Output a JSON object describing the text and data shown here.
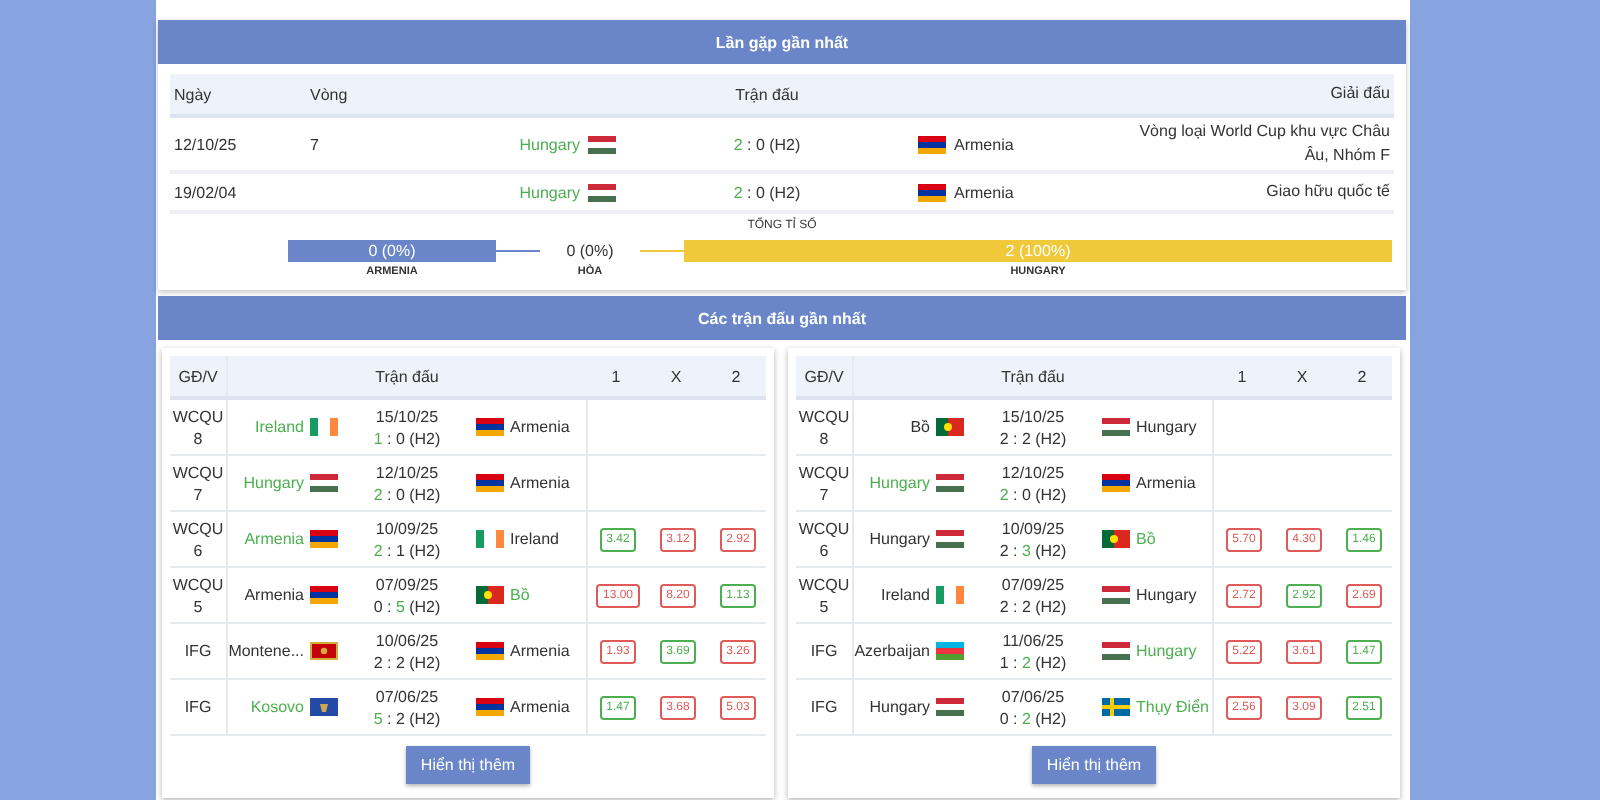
{
  "h2h": {
    "title": "Lần gặp gần nhất",
    "columns": [
      "Ngày",
      "Vòng",
      "Trận đấu",
      "Giải đấu"
    ],
    "rows": [
      {
        "date": "12/10/25",
        "round": "7",
        "home": {
          "name": "Hungary",
          "kind": "hungary",
          "won": true
        },
        "score_home": "2",
        "separator": ":",
        "score_away": "0",
        "note": "(H2)",
        "away": {
          "name": "Armenia",
          "kind": "armenia",
          "won": false
        },
        "league": "Vòng loại World Cup khu vực Châu Âu, Nhóm F"
      },
      {
        "date": "19/02/04",
        "home": {
          "name": "Hungary",
          "kind": "hungary",
          "won": true
        },
        "score_home": "2",
        "separator": ":",
        "score_away": "0",
        "note": "(H2)",
        "away": {
          "name": "Armenia",
          "kind": "armenia",
          "won": false
        },
        "league": "Giao hữu quốc tế"
      }
    ],
    "summary_title": "TỔNG TỈ SỐ",
    "totals": [
      {
        "kind": "away",
        "value": "0 (0%)",
        "label": "ARMENIA"
      },
      {
        "kind": "draw",
        "value": "0 (0%)",
        "label": "HÒA"
      },
      {
        "kind": "home",
        "value": "2 (100%)",
        "label": "HUNGARY"
      }
    ]
  },
  "recent": {
    "title": "Các trận đấu gần nhất",
    "cards": [
      {
        "columns": [
          "GĐ/V",
          "Trận đấu",
          "1",
          "X",
          "2"
        ],
        "button": "Hiển thị thêm",
        "rows": [
          {
            "round": "WCQU 8",
            "home": {
              "name": "Ireland",
              "kind": "ireland",
              "won": true
            },
            "date": "15/10/25",
            "score_home": "1",
            "separator": ":",
            "score_away": "0",
            "note": "(H2)",
            "away": {
              "name": "Armenia",
              "kind": "armenia",
              "won": false
            }
          },
          {
            "round": "WCQU 7",
            "home": {
              "name": "Hungary",
              "kind": "hungary",
              "won": true
            },
            "date": "12/10/25",
            "score_home": "2",
            "separator": ":",
            "score_away": "0",
            "note": "(H2)",
            "away": {
              "name": "Armenia",
              "kind": "armenia",
              "won": false
            }
          },
          {
            "round": "WCQU 6",
            "home": {
              "name": "Armenia",
              "kind": "armenia",
              "won": true
            },
            "date": "10/09/25",
            "score_home": "2",
            "separator": ":",
            "score_away": "1",
            "note": "(H2)",
            "away": {
              "name": "Ireland",
              "kind": "ireland",
              "won": false
            },
            "odds": [
              {
                "value": "3.42",
                "color": "#4caf50"
              },
              {
                "value": "3.12",
                "color": "#e05a5a"
              },
              {
                "value": "2.92",
                "color": "#e05a5a"
              }
            ]
          },
          {
            "round": "WCQU 5",
            "home": {
              "name": "Armenia",
              "kind": "armenia",
              "won": false
            },
            "date": "07/09/25",
            "score_home": "0",
            "separator": ":",
            "score_away": "5",
            "note": "(H2)",
            "away": {
              "name": "Bồ",
              "kind": "portugal",
              "won": true
            },
            "odds": [
              {
                "value": "13.00",
                "color": "#e05a5a"
              },
              {
                "value": "8.20",
                "color": "#e05a5a"
              },
              {
                "value": "1.13",
                "color": "#4caf50"
              }
            ]
          },
          {
            "round": "IFG",
            "home": {
              "name": "Montene...",
              "kind": "montenegro",
              "won": false
            },
            "date": "10/06/25",
            "score_home": "2",
            "separator": ":",
            "score_away": "2",
            "note": "(H2)",
            "away": {
              "name": "Armenia",
              "kind": "armenia",
              "won": false
            },
            "odds": [
              {
                "value": "1.93",
                "color": "#e05a5a"
              },
              {
                "value": "3.69",
                "color": "#4caf50"
              },
              {
                "value": "3.26",
                "color": "#e05a5a"
              }
            ]
          },
          {
            "round": "IFG",
            "home": {
              "name": "Kosovo",
              "kind": "kosovo",
              "won": true
            },
            "date": "07/06/25",
            "score_home": "5",
            "separator": ":",
            "score_away": "2",
            "note": "(H2)",
            "away": {
              "name": "Armenia",
              "kind": "armenia",
              "won": false
            },
            "odds": [
              {
                "value": "1.47",
                "color": "#4caf50"
              },
              {
                "value": "3.68",
                "color": "#e05a5a"
              },
              {
                "value": "5.03",
                "color": "#e05a5a"
              }
            ]
          }
        ]
      },
      {
        "columns": [
          "GĐ/V",
          "Trận đấu",
          "1",
          "X",
          "2"
        ],
        "button": "Hiển thị thêm",
        "rows": [
          {
            "round": "WCQU 8",
            "home": {
              "name": "Bồ",
              "kind": "portugal",
              "won": false
            },
            "date": "15/10/25",
            "score_home": "2",
            "separator": ":",
            "score_away": "2",
            "note": "(H2)",
            "away": {
              "name": "Hungary",
              "kind": "hungary",
              "won": false
            }
          },
          {
            "round": "WCQU 7",
            "home": {
              "name": "Hungary",
              "kind": "hungary",
              "won": true
            },
            "date": "12/10/25",
            "score_home": "2",
            "separator": ":",
            "score_away": "0",
            "note": "(H2)",
            "away": {
              "name": "Armenia",
              "kind": "armenia",
              "won": false
            }
          },
          {
            "round": "WCQU 6",
            "home": {
              "name": "Hungary",
              "kind": "hungary",
              "won": false
            },
            "date": "10/09/25",
            "score_home": "2",
            "separator": ":",
            "score_away": "3",
            "note": "(H2)",
            "away": {
              "name": "Bồ",
              "kind": "portugal",
              "won": true
            },
            "odds": [
              {
                "value": "5.70",
                "color": "#e05a5a"
              },
              {
                "value": "4.30",
                "color": "#e05a5a"
              },
              {
                "value": "1.46",
                "color": "#4caf50"
              }
            ]
          },
          {
            "round": "WCQU 5",
            "home": {
              "name": "Ireland",
              "kind": "ireland",
              "won": false
            },
            "date": "07/09/25",
            "score_home": "2",
            "separator": ":",
            "score_away": "2",
            "note": "(H2)",
            "away": {
              "name": "Hungary",
              "kind": "hungary",
              "won": false
            },
            "odds": [
              {
                "value": "2.72",
                "color": "#e05a5a"
              },
              {
                "value": "2.92",
                "color": "#4caf50"
              },
              {
                "value": "2.69",
                "color": "#e05a5a"
              }
            ]
          },
          {
            "round": "IFG",
            "home": {
              "name": "Azerbaijan",
              "kind": "azerbaijan",
              "won": false
            },
            "date": "11/06/25",
            "score_home": "1",
            "separator": ":",
            "score_away": "2",
            "note": "(H2)",
            "away": {
              "name": "Hungary",
              "kind": "hungary",
              "won": true
            },
            "odds": [
              {
                "value": "5.22",
                "color": "#e05a5a"
              },
              {
                "value": "3.61",
                "color": "#e05a5a"
              },
              {
                "value": "1.47",
                "color": "#4caf50"
              }
            ]
          },
          {
            "round": "IFG",
            "home": {
              "name": "Hungary",
              "kind": "hungary",
              "won": false
            },
            "date": "07/06/25",
            "score_home": "0",
            "separator": ":",
            "score_away": "2",
            "note": "(H2)",
            "away": {
              "name": "Thụy Điển",
              "kind": "sweden",
              "won": true
            },
            "odds": [
              {
                "value": "2.56",
                "color": "#e05a5a"
              },
              {
                "value": "3.09",
                "color": "#e05a5a"
              },
              {
                "value": "2.51",
                "color": "#4caf50"
              }
            ]
          }
        ]
      }
    ]
  }
}
